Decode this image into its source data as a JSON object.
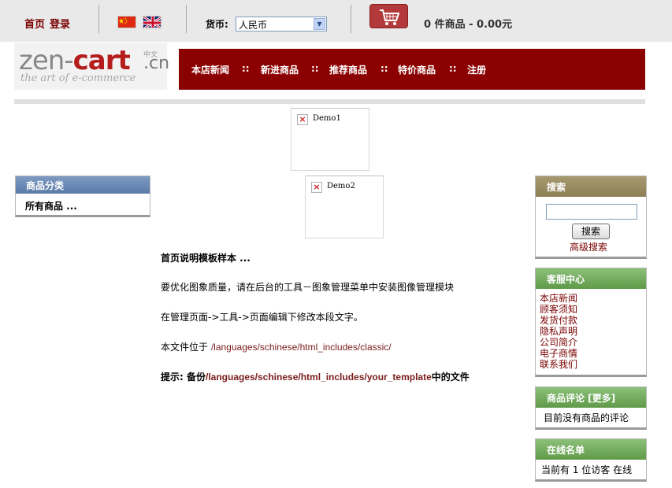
{
  "topbar": {
    "home_label": "首页",
    "login_label": "登录",
    "currency_label": "货币:",
    "currency_value": "人民币",
    "cart_summary": "0 件商品 - 0.00元"
  },
  "header": {
    "logo_main_prefix": "zen-",
    "logo_main_suffix": "cart",
    "logo_cn": ".cn",
    "logo_cn_small": "中文",
    "logo_tagline": "the art of e-commerce",
    "nav": [
      "本店新闻",
      "新进商品",
      "推荐商品",
      "特价商品",
      "注册"
    ],
    "nav_separator": "::"
  },
  "demos": [
    {
      "label": "Demo1"
    },
    {
      "label": "Demo2"
    }
  ],
  "categories": {
    "title": "商品分类",
    "all_products": "所有商品 ..."
  },
  "content": {
    "heading": "首页说明模板样本 ...",
    "line1": "要优化图象质量，请在后台的工具－图象管理菜单中安装图像管理模块",
    "line2": "在管理页面->工具->页面编辑下修改本段文字。",
    "line3_prefix": "本文件位于 ",
    "line3_path": "/languages/schinese/html_includes/classic/",
    "line4_prefix": "提示: 备份",
    "line4_path": "/languages/schinese/html_includes/your_template",
    "line4_suffix": "中的文件"
  },
  "search": {
    "title": "搜索",
    "input_value": "",
    "button_label": "搜索",
    "advanced_label": "高级搜索"
  },
  "service": {
    "title": "客服中心",
    "links": [
      "本店新闻",
      "顾客须知",
      "发货付款",
      "隐私声明",
      "公司简介",
      "电子商情",
      "联系我们"
    ]
  },
  "reviews": {
    "title": "商品评论 [更多]",
    "body": "目前没有商品的评论"
  },
  "online": {
    "title": "在线名单",
    "body": "当前有 1 位访客 在线"
  },
  "colors": {
    "nav_background": "#8b0000",
    "link_color": "#7a0000",
    "category_header": "#6a88b4",
    "search_header": "#9b8d62",
    "green_header": "#74ad5e"
  },
  "icons": [
    "china-flag-icon",
    "uk-flag-icon",
    "shopping-cart-icon",
    "broken-image-icon"
  ]
}
